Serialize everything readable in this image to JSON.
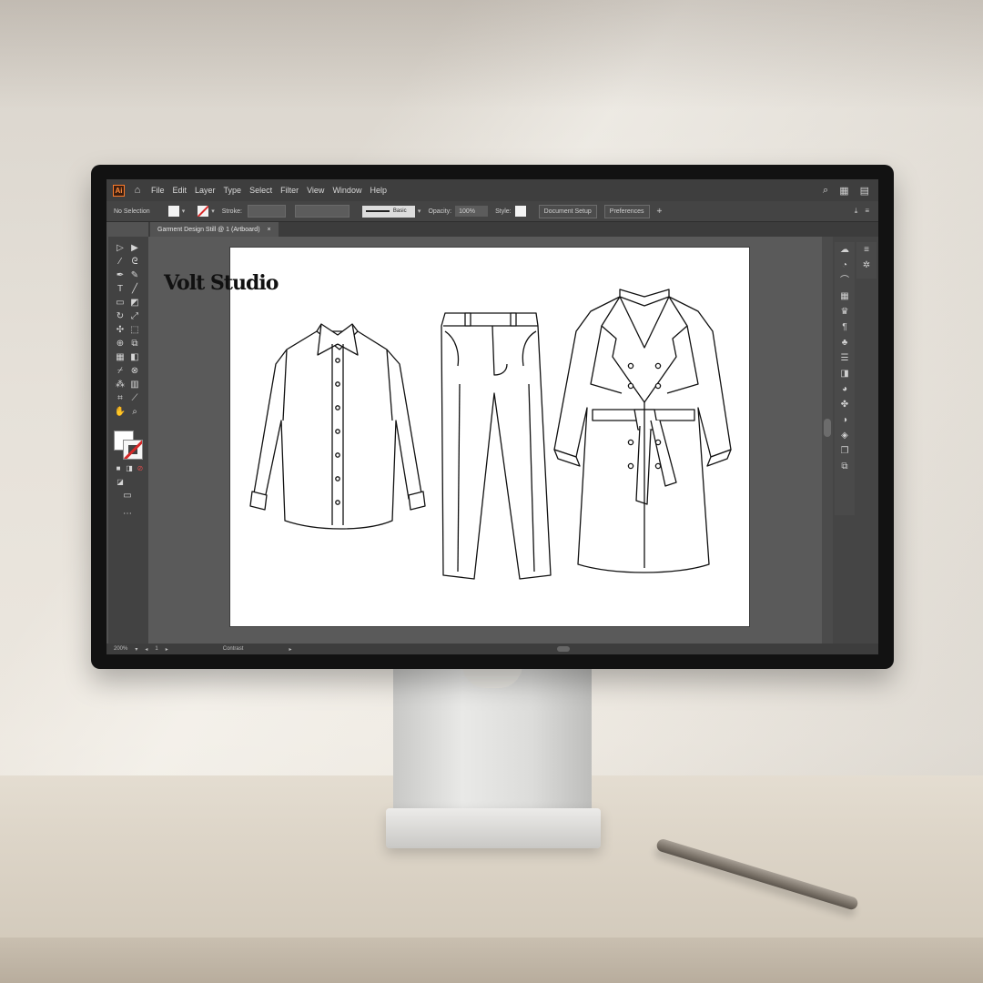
{
  "app": {
    "logo_text": "Ai",
    "menu": [
      "File",
      "Edit",
      "Layer",
      "Type",
      "Select",
      "Filter",
      "View",
      "Window",
      "Help"
    ]
  },
  "controlbar": {
    "selection_label": "No Selection",
    "stroke_label": "Stroke:",
    "stroke_style_label": "Basic",
    "opacity_label": "Opacity:",
    "opacity_value": "100%",
    "style_label": "Style:",
    "btn_document_setup": "Document Setup",
    "btn_preferences": "Preferences"
  },
  "document_tab": {
    "title": "Garment Design Still @ 1 (Artboard)",
    "close": "×"
  },
  "artboard": {
    "brand": "Volt Studio",
    "garments": [
      "shirt",
      "trousers",
      "trench-coat"
    ]
  },
  "statusbar": {
    "zoom": "200%",
    "artboard_num": "1",
    "status_text": "Contrast"
  },
  "colors": {
    "accent": "#ff7c2a",
    "none_swatch": "#d92a2a"
  }
}
